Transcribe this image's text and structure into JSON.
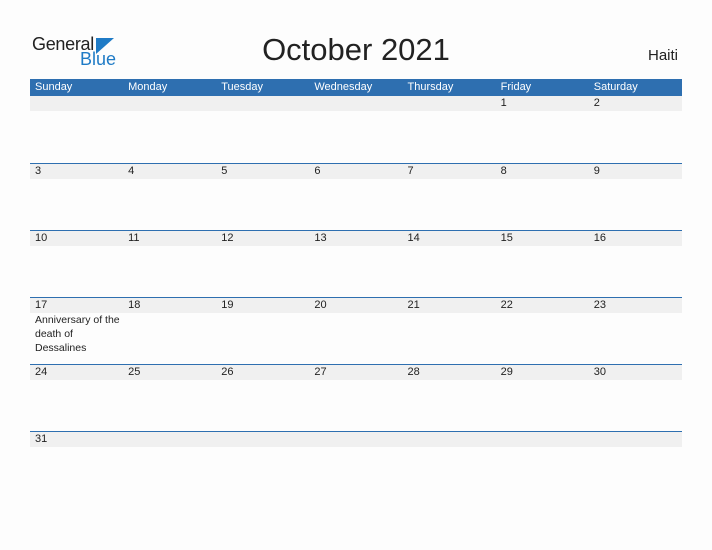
{
  "logo": {
    "general": "General",
    "blue": "Blue"
  },
  "title": "October 2021",
  "country": "Haiti",
  "colors": {
    "accent": "#2e6fb0",
    "band": "#f0f0f0",
    "logo_blue": "#1f7bc6"
  },
  "weekdays": [
    "Sunday",
    "Monday",
    "Tuesday",
    "Wednesday",
    "Thursday",
    "Friday",
    "Saturday"
  ],
  "weeks": [
    [
      {
        "d": ""
      },
      {
        "d": ""
      },
      {
        "d": ""
      },
      {
        "d": ""
      },
      {
        "d": ""
      },
      {
        "d": "1"
      },
      {
        "d": "2"
      }
    ],
    [
      {
        "d": "3"
      },
      {
        "d": "4"
      },
      {
        "d": "5"
      },
      {
        "d": "6"
      },
      {
        "d": "7"
      },
      {
        "d": "8"
      },
      {
        "d": "9"
      }
    ],
    [
      {
        "d": "10"
      },
      {
        "d": "11"
      },
      {
        "d": "12"
      },
      {
        "d": "13"
      },
      {
        "d": "14"
      },
      {
        "d": "15"
      },
      {
        "d": "16"
      }
    ],
    [
      {
        "d": "17",
        "event": "Anniversary of the death of Dessalines"
      },
      {
        "d": "18"
      },
      {
        "d": "19"
      },
      {
        "d": "20"
      },
      {
        "d": "21"
      },
      {
        "d": "22"
      },
      {
        "d": "23"
      }
    ],
    [
      {
        "d": "24"
      },
      {
        "d": "25"
      },
      {
        "d": "26"
      },
      {
        "d": "27"
      },
      {
        "d": "28"
      },
      {
        "d": "29"
      },
      {
        "d": "30"
      }
    ],
    [
      {
        "d": "31"
      },
      {
        "d": ""
      },
      {
        "d": ""
      },
      {
        "d": ""
      },
      {
        "d": ""
      },
      {
        "d": ""
      },
      {
        "d": ""
      }
    ]
  ]
}
